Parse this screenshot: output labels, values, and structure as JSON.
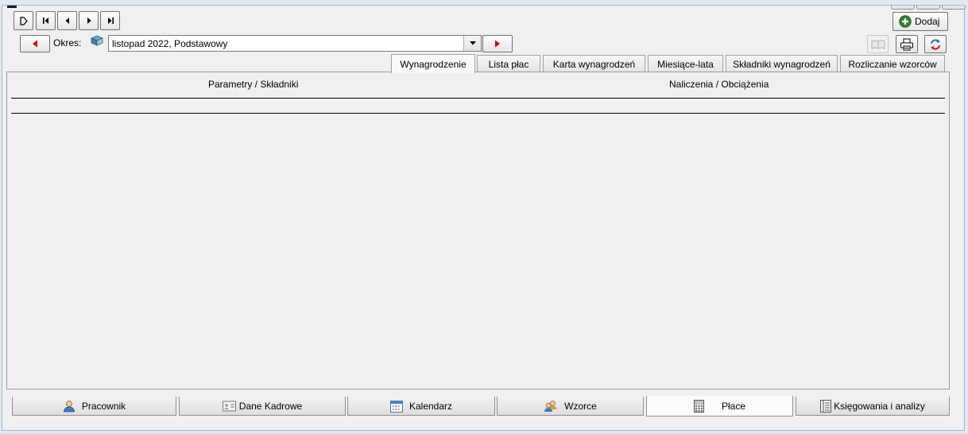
{
  "toolbar": {
    "nav_buttons": [
      "new-record",
      "first-record",
      "previous-record",
      "next-record",
      "last-record"
    ],
    "add_label": "Dodaj"
  },
  "period": {
    "label": "Okres:",
    "value": "listopad 2022, Podstawowy"
  },
  "tabs": [
    {
      "label": "Wynagrodzenie",
      "active": true
    },
    {
      "label": "Lista płac",
      "active": false
    },
    {
      "label": "Karta wynagrodzeń",
      "active": false
    },
    {
      "label": "Miesiące-lata",
      "active": false
    },
    {
      "label": "Składniki wynagrodzeń",
      "active": false
    },
    {
      "label": "Rozliczanie wzorców",
      "active": false
    }
  ],
  "grid": {
    "col_left": "Parametry / Składniki",
    "col_right": "Naliczenia / Obciążenia"
  },
  "bottom_tabs": [
    {
      "label": "Pracownik",
      "icon": "person-icon",
      "active": false
    },
    {
      "label": "Dane Kadrowe",
      "icon": "id-card-icon",
      "active": false
    },
    {
      "label": "Kalendarz",
      "icon": "calendar-icon",
      "active": false
    },
    {
      "label": "Wzorce",
      "icon": "people-group-icon",
      "active": false
    },
    {
      "label": "Płace",
      "icon": "calculator-icon",
      "active": true
    },
    {
      "label": "Księgowania i analizy",
      "icon": "ledger-icon",
      "active": false
    }
  ],
  "colors": {
    "accent_red": "#d40000",
    "add_green": "#2f7d32",
    "window_bg": "#f0f0f0"
  }
}
